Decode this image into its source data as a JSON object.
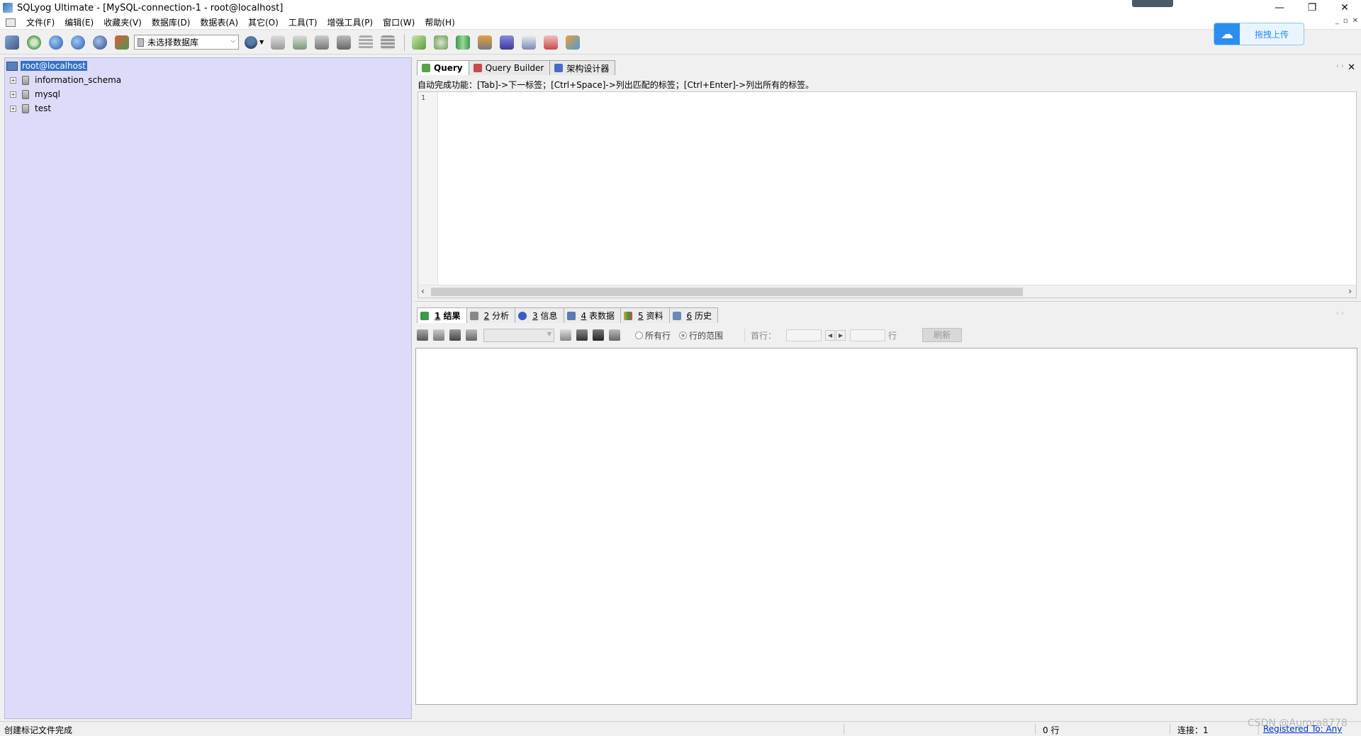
{
  "window": {
    "title": "SQLyog Ultimate - [MySQL-connection-1 - root@localhost]",
    "controls": {
      "minimize": "—",
      "restore": "❐",
      "close": "✕"
    },
    "mdi_controls": {
      "minimize": "_",
      "restore": "▫",
      "close": "✕"
    }
  },
  "menu": {
    "items": [
      "文件(F)",
      "编辑(E)",
      "收藏夹(V)",
      "数据库(D)",
      "数据表(A)",
      "其它(O)",
      "工具(T)",
      "增强工具(P)",
      "窗口(W)",
      "帮助(H)"
    ]
  },
  "toolbar": {
    "db_selector": {
      "value": "未选择数据库"
    },
    "icons": [
      "new-connection-icon",
      "refresh-icon",
      "execute-icon",
      "execute-all-icon",
      "stop-icon",
      "new-db-icon",
      "user-manager-icon",
      "backup-icon",
      "restore-icon",
      "export-icon",
      "import-icon",
      "table-icon",
      "schema-sync-icon",
      "data-sync-icon",
      "copy-db-icon",
      "copy-table-icon",
      "query-builder-icon",
      "server-monitor-icon",
      "report-icon",
      "schema-designer-icon"
    ]
  },
  "upload_widget": {
    "label": "拖拽上传"
  },
  "tree": {
    "root": "root@localhost",
    "databases": [
      "information_schema",
      "mysql",
      "test"
    ]
  },
  "query_tabs": [
    {
      "label": "Query",
      "active": true,
      "icon_color": "#5aa04a"
    },
    {
      "label": "Query Builder",
      "active": false,
      "icon_color": "#c84a4a"
    },
    {
      "label": "架构设计器",
      "active": false,
      "icon_color": "#4a6ac8"
    }
  ],
  "editor": {
    "autocomplete_hint": "自动完成功能：[Tab]->下一标签；[Ctrl+Space]->列出匹配的标签；[Ctrl+Enter]->列出所有的标签。",
    "line_number": "1"
  },
  "result_tabs": [
    {
      "num": "1",
      "label": "结果",
      "active": true,
      "icon_color": "#3a9a4a"
    },
    {
      "num": "2",
      "label": "分析",
      "active": false,
      "icon_color": "#888888"
    },
    {
      "num": "3",
      "label": "信息",
      "active": false,
      "icon_color": "#3a5ac8"
    },
    {
      "num": "4",
      "label": "表数据",
      "active": false,
      "icon_color": "#5a7ab8"
    },
    {
      "num": "5",
      "label": "资料",
      "active": false,
      "icon_color": "#d8a030"
    },
    {
      "num": "6",
      "label": "历史",
      "active": false,
      "icon_color": "#6a8ab8"
    }
  ],
  "result_toolbar": {
    "radio_all_rows": "所有行",
    "radio_row_range": "行的范围",
    "first_row_label": "首行：",
    "rows_label": "行",
    "refresh": "刷新"
  },
  "status": {
    "message": "创建标记文件完成",
    "rows": "0 行",
    "connections": "连接：1",
    "registered": "Registered To: Any"
  },
  "watermark": "CSDN @Aurora8778"
}
